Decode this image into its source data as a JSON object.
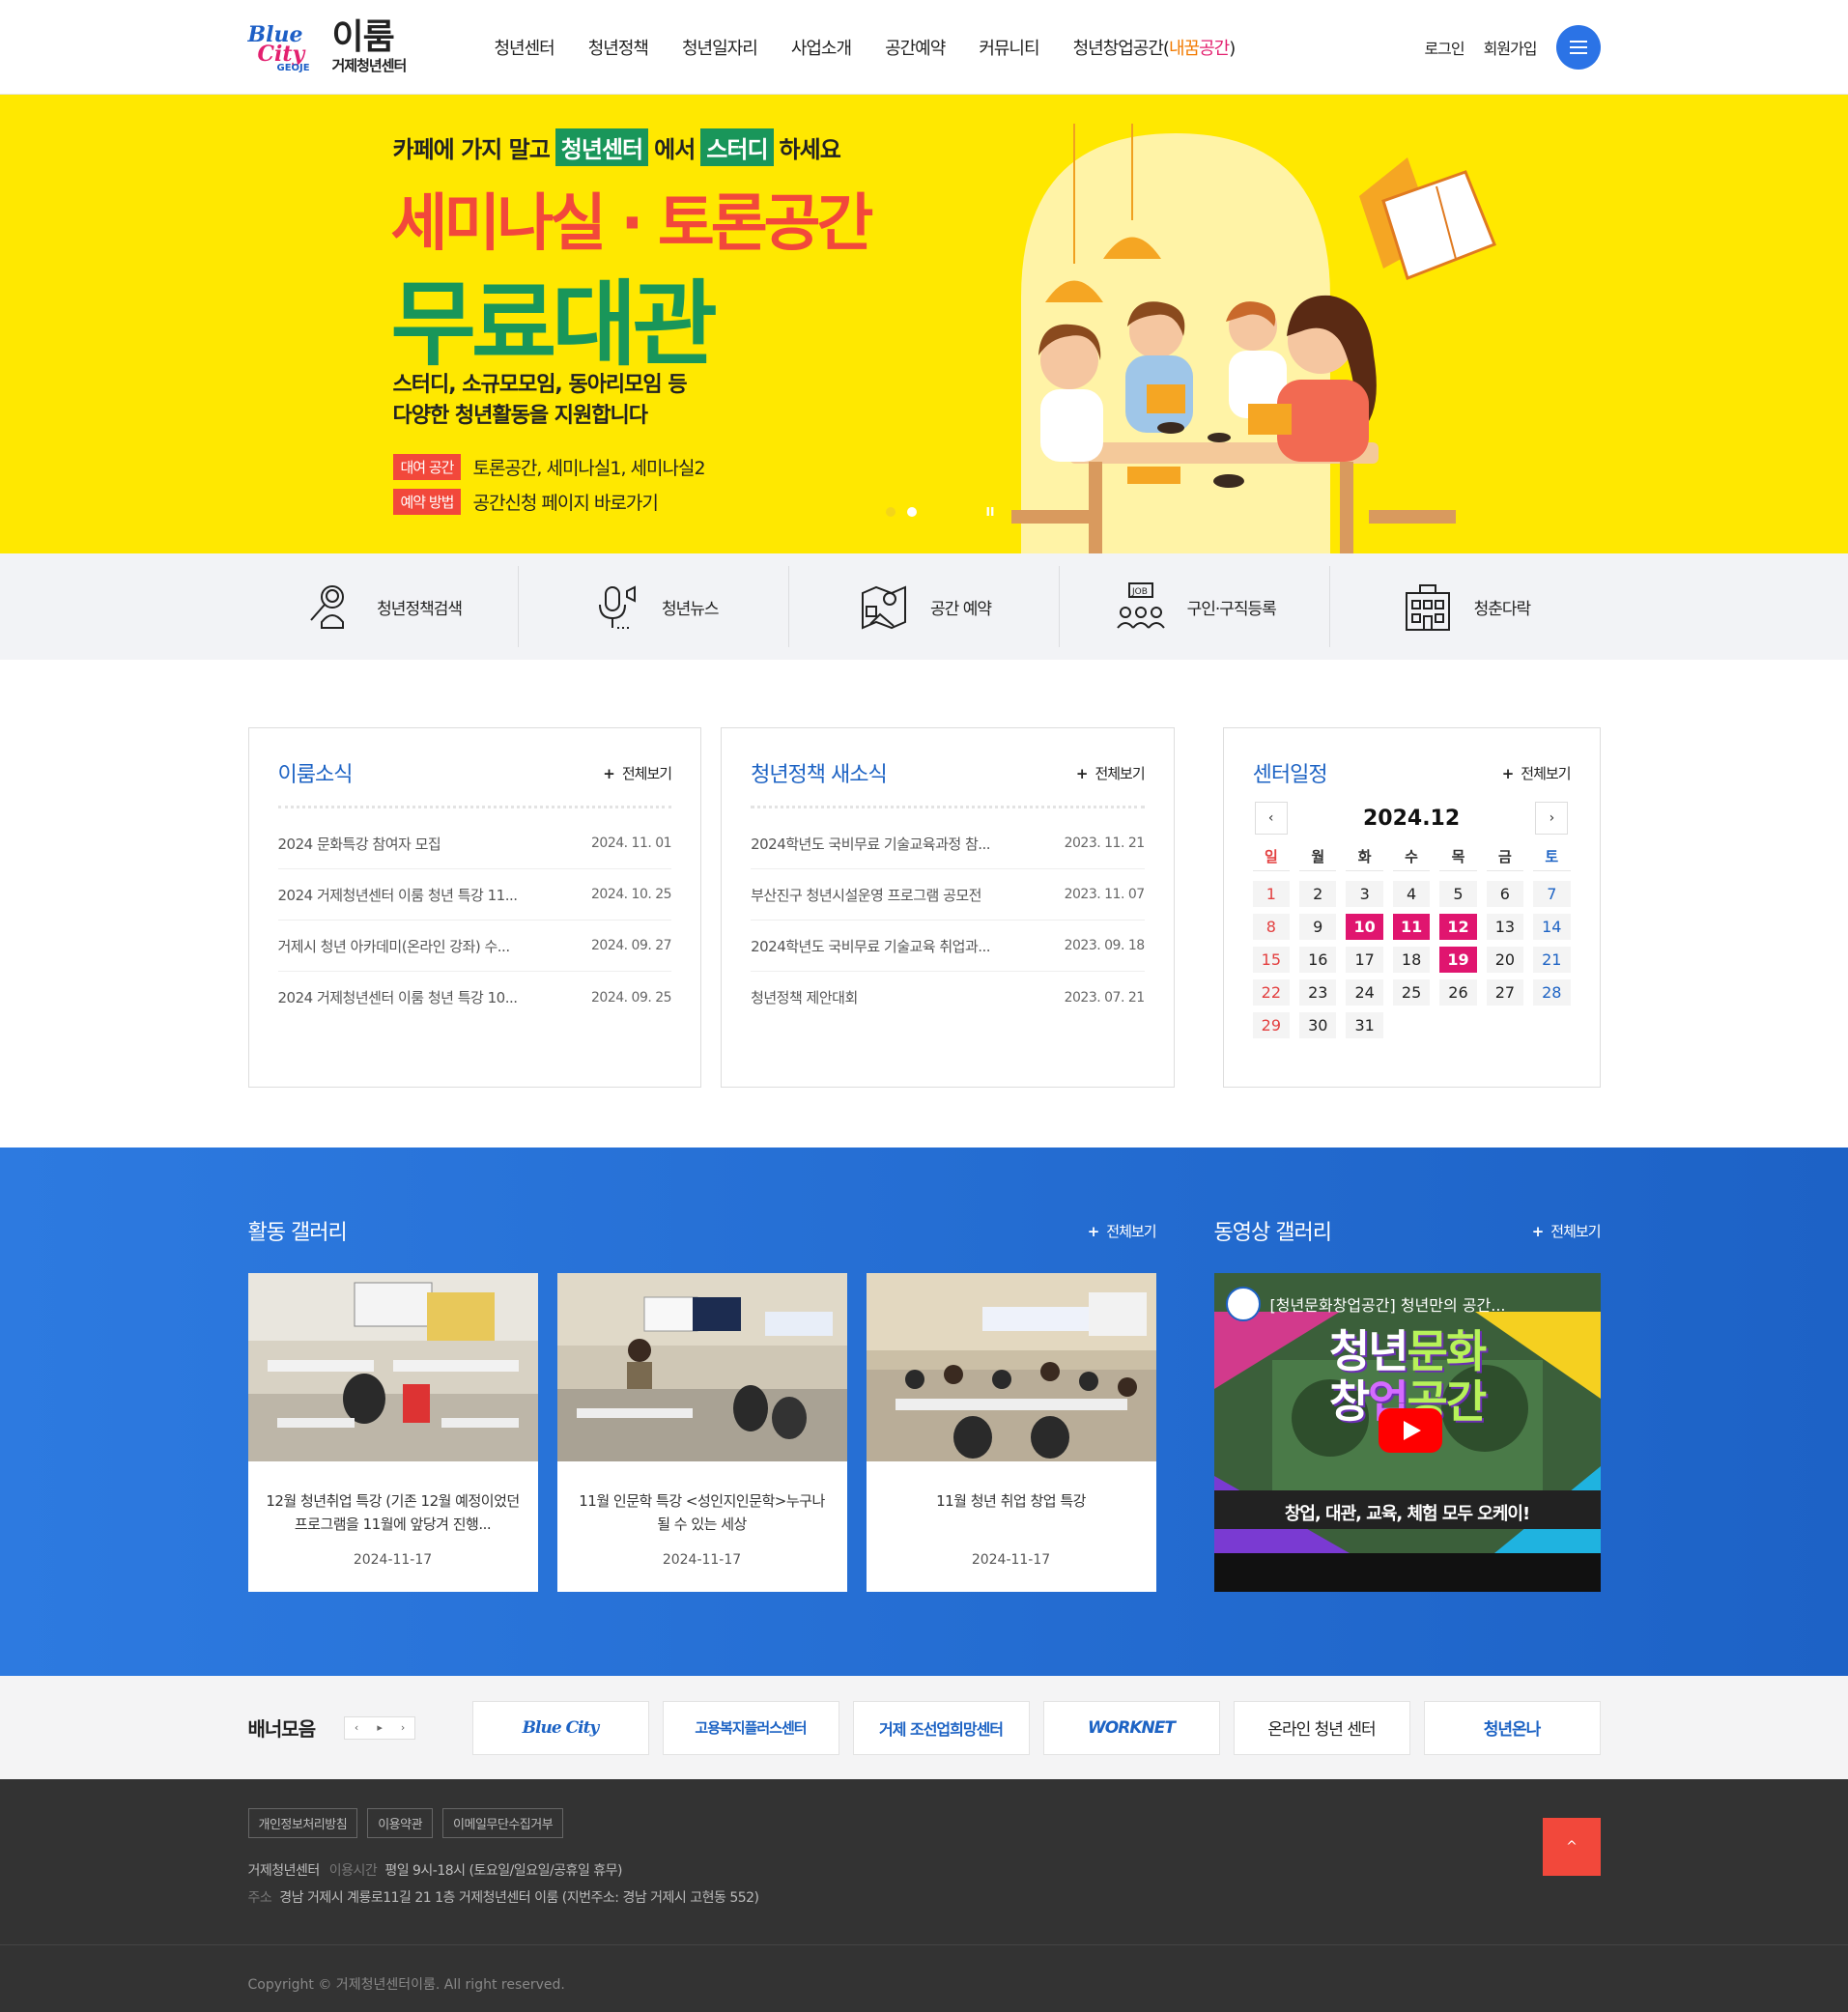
{
  "header": {
    "logo_text": "이룸",
    "logo_sub": "거제청년센터",
    "logo_mark_1": "Blue",
    "logo_mark_2": "City",
    "logo_mark_3": "GEOJE",
    "nav": [
      "청년센터",
      "청년정책",
      "청년일자리",
      "사업소개",
      "공간예약",
      "커뮤니티"
    ],
    "nav_last_prefix": "청년창업공간(",
    "nav_last_hl1": "내꿈",
    "nav_last_hl2": "공간",
    "nav_last_suffix": ")",
    "login": "로그인",
    "join": "회원가입",
    "menu_icon": "hamburger-icon",
    "accent": "#2b73e6"
  },
  "hero": {
    "line1_a": "카페에 가지 말고",
    "line1_tag1": "청년센터",
    "line1_b": "에서",
    "line1_tag2": "스터디",
    "line1_c": "하세요",
    "line2": "세미나실 · 토론공간",
    "line3": "무료대관",
    "line4a": "스터디, 소규모모임, 동아리모임 등",
    "line4b": "다양한 청년활동을 지원합니다",
    "info_label1": "대여 공간",
    "info_value1": "토론공간, 세미나실1, 세미나실2",
    "info_label2": "예약 방법",
    "info_value2": "공간신청 페이지 바로가기",
    "pause": "II",
    "bg": "#ffe800"
  },
  "quick": [
    {
      "icon": "policy-search-icon",
      "label": "청년정책검색"
    },
    {
      "icon": "microphone-icon",
      "label": "청년뉴스"
    },
    {
      "icon": "space-booking-icon",
      "label": "공간 예약"
    },
    {
      "icon": "job-icon",
      "label": "구인·구직등록"
    },
    {
      "icon": "building-icon",
      "label": "청춘다락"
    }
  ],
  "boards": {
    "news": {
      "title": "이룸소식",
      "more": "전체보기",
      "items": [
        {
          "title": "2024 문화특강 참여자 모집",
          "date": "2024. 11. 01"
        },
        {
          "title": "2024 거제청년센터 이룸 청년 특강 11...",
          "date": "2024. 10. 25"
        },
        {
          "title": "거제시 청년 아카데미(온라인 강좌) 수...",
          "date": "2024. 09. 27"
        },
        {
          "title": "2024 거제청년센터 이룸 청년 특강 10...",
          "date": "2024. 09. 25"
        }
      ]
    },
    "policy": {
      "title": "청년정책 새소식",
      "more": "전체보기",
      "items": [
        {
          "title": "2024학년도 국비무료 기술교육과정 참...",
          "date": "2023. 11. 21"
        },
        {
          "title": "부산진구 청년시설운영 프로그램 공모전",
          "date": "2023. 11. 07"
        },
        {
          "title": "2024학년도 국비무료 기술교육 취업과...",
          "date": "2023. 09. 18"
        },
        {
          "title": "청년정책 제안대회",
          "date": "2023. 07. 21"
        }
      ]
    },
    "calendar": {
      "title": "센터일정",
      "more": "전체보기",
      "month": "2024.12",
      "prev": "‹",
      "next": "›",
      "weekdays": [
        "일",
        "월",
        "화",
        "수",
        "목",
        "금",
        "토"
      ],
      "days": [
        "1",
        "2",
        "3",
        "4",
        "5",
        "6",
        "7",
        "8",
        "9",
        "10",
        "11",
        "12",
        "13",
        "14",
        "15",
        "16",
        "17",
        "18",
        "19",
        "20",
        "21",
        "22",
        "23",
        "24",
        "25",
        "26",
        "27",
        "28",
        "29",
        "30",
        "31"
      ],
      "event_days": [
        10,
        11,
        12,
        19
      ],
      "event_color": "#e0156f"
    }
  },
  "gallery": {
    "title": "활동 갤러리",
    "more": "전체보기",
    "items": [
      {
        "caption": "12월 청년취업 특강 (기존 12월 예정이었던 프로그램을 11월에 앞당겨 진행...",
        "date": "2024-11-17"
      },
      {
        "caption": "11월 인문학 특강 <성인지인문학>누구나 될 수 있는 세상",
        "date": "2024-11-17"
      },
      {
        "caption": "11월 청년 취업 창업 특강",
        "date": "2024-11-17"
      }
    ]
  },
  "video": {
    "title": "동영상 갤러리",
    "more": "전체보기",
    "video_title": "[청년문화창업공간] 청년만의 공간...",
    "big_line1_a": "청년",
    "big_line1_b": "문화",
    "big_line2_a": "창",
    "big_line2_b": "업",
    "big_line2_c": "공간",
    "subtitle": "창업, 대관, 교육, 체험 모두 오케이!"
  },
  "banners": {
    "title": "배너모음",
    "prev": "‹",
    "stop": "▸",
    "next": "›",
    "logos": [
      "Blue City",
      "고용복지플러스센터",
      "거제 조선업희망센터",
      "WORKNET",
      "온라인 청년 센터",
      "청년온나"
    ]
  },
  "footer": {
    "links": [
      "개인정보처리방침",
      "이용약관",
      "이메일무단수집거부"
    ],
    "org_key": "거제청년센터",
    "hours_key": "이용시간",
    "hours_val": "평일 9시-18시 (토요일/일요일/공휴일 휴무)",
    "addr_key": "주소",
    "addr_val": "경남 거제시 계룡로11길 21 1층 거제청년센터 이룸 (지번주소: 경남 거제시 고현동 552)",
    "copyright": "Copyright © 거제청년센터이룸. All right reserved.",
    "top": "^"
  }
}
